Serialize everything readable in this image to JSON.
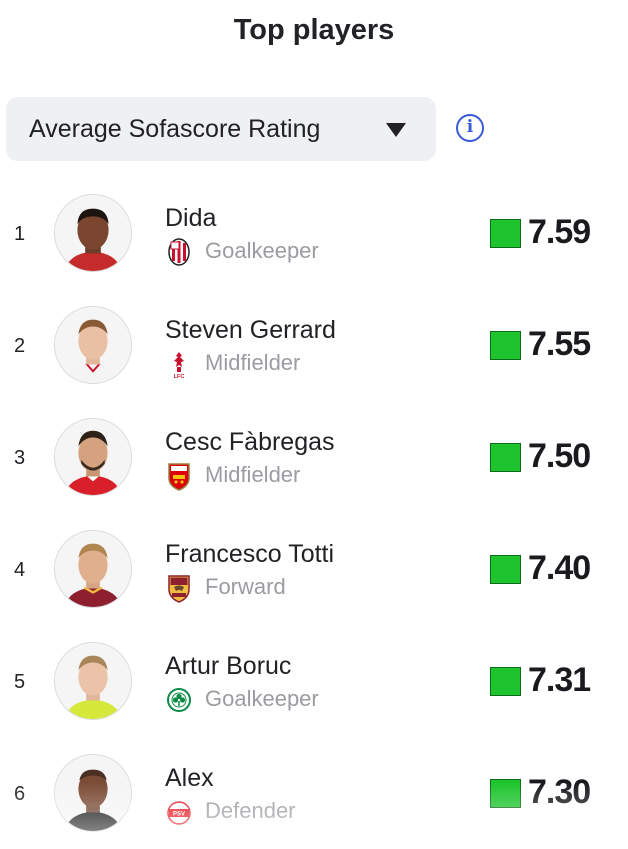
{
  "header": {
    "title": "Top players"
  },
  "selector": {
    "value": "Average Sofascore Rating",
    "info_glyph": "i"
  },
  "colors": {
    "rating_badge": "#1ec42e",
    "accent": "#3a5ad8"
  },
  "players": [
    {
      "rank": "1",
      "name": "Dida",
      "position": "Goalkeeper",
      "rating": "7.59",
      "club_icon": "ac-milan-crest-icon"
    },
    {
      "rank": "2",
      "name": "Steven Gerrard",
      "position": "Midfielder",
      "rating": "7.55",
      "club_icon": "liverpool-crest-icon"
    },
    {
      "rank": "3",
      "name": "Cesc Fàbregas",
      "position": "Midfielder",
      "rating": "7.50",
      "club_icon": "arsenal-crest-icon"
    },
    {
      "rank": "4",
      "name": "Francesco Totti",
      "position": "Forward",
      "rating": "7.40",
      "club_icon": "as-roma-crest-icon"
    },
    {
      "rank": "5",
      "name": "Artur Boruc",
      "position": "Goalkeeper",
      "rating": "7.31",
      "club_icon": "celtic-crest-icon"
    },
    {
      "rank": "6",
      "name": "Alex",
      "position": "Defender",
      "rating": "7.30",
      "club_icon": "psv-crest-icon"
    }
  ]
}
